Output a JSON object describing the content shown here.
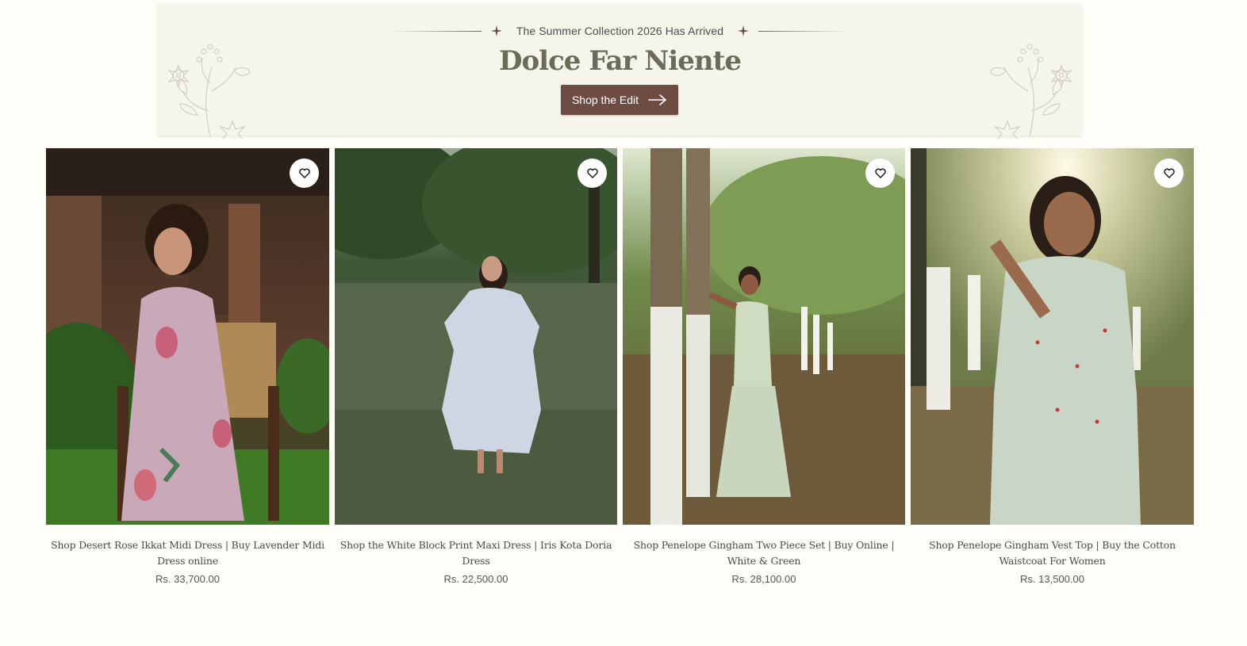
{
  "banner": {
    "eyebrow": "The Summer Collection 2026 Has Arrived",
    "title": "Dolce Far Niente",
    "cta_label": "Shop the Edit",
    "accent_color": "#6e4c43",
    "background_color": "#f6f5ec"
  },
  "products": [
    {
      "title": "Shop Desert Rose Ikkat Midi Dress | Buy Lavender Midi Dress online",
      "price": "Rs. 33,700.00",
      "wishlist_icon": "heart-icon"
    },
    {
      "title": "Shop the White Block Print Maxi Dress | Iris Kota Doria Dress",
      "price": "Rs. 22,500.00",
      "wishlist_icon": "heart-icon"
    },
    {
      "title": "Shop Penelope Gingham Two Piece Set | Buy Online | White & Green",
      "price": "Rs. 28,100.00",
      "wishlist_icon": "heart-icon"
    },
    {
      "title": "Shop Penelope Gingham Vest Top | Buy the Cotton Waistcoat For Women",
      "price": "Rs. 13,500.00",
      "wishlist_icon": "heart-icon"
    }
  ]
}
